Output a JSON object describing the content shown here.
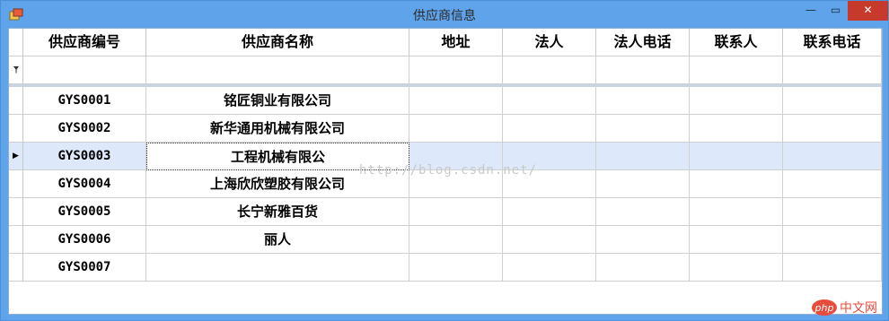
{
  "window": {
    "title": "供应商信息",
    "min_label": "—",
    "max_label": "▭",
    "close_label": "✕"
  },
  "columns": [
    "供应商编号",
    "供应商名称",
    "地址",
    "法人",
    "法人电话",
    "联系人",
    "联系电话"
  ],
  "filter_row_icon": "filter-icon",
  "rows": [
    {
      "code": "GYS0001",
      "name": "铭匠铜业有限公司"
    },
    {
      "code": "GYS0002",
      "name": "新华通用机械有限公司"
    },
    {
      "code": "GYS0003",
      "name": "工程机械有限公",
      "selected": true
    },
    {
      "code": "GYS0004",
      "name": "上海欣欣塑胶有限公司"
    },
    {
      "code": "GYS0005",
      "name": "长宁新雅百货"
    },
    {
      "code": "GYS0006",
      "name": "丽人"
    },
    {
      "code": "GYS0007",
      "name": ""
    }
  ],
  "watermark": "http://blog.csdn.net/",
  "logo_text": {
    "php": "php",
    "site": "中文网"
  },
  "colors": {
    "titlebar": "#5fa3ea",
    "close": "#c7392b",
    "selected_row": "#dde8fb"
  }
}
